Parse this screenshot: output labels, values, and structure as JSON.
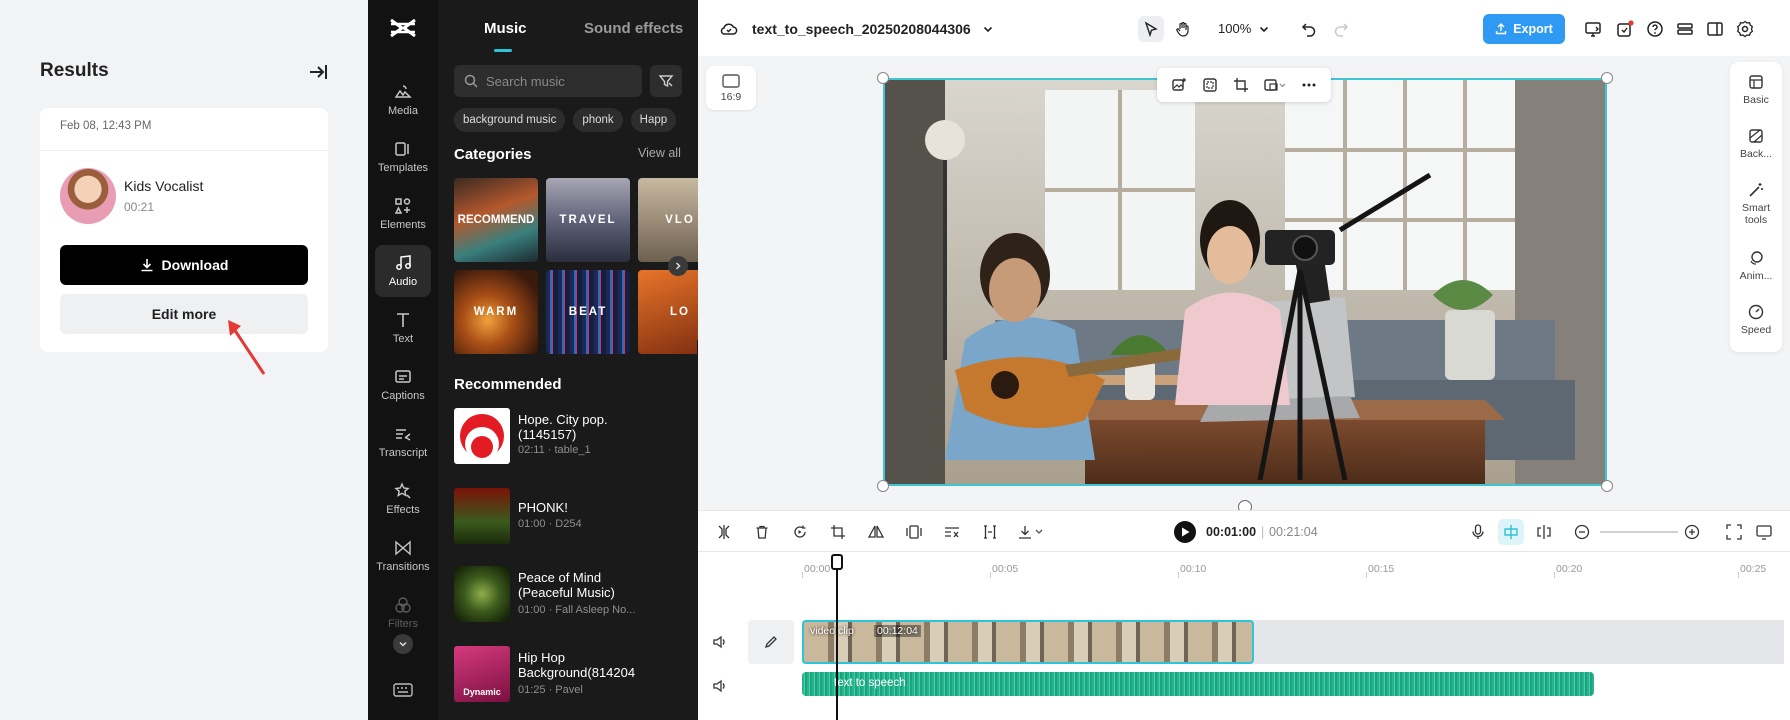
{
  "results": {
    "title": "Results",
    "card": {
      "date": "Feb 08, 12:43 PM",
      "voice_name": "Kids Vocalist",
      "duration": "00:21",
      "download_label": "Download",
      "edit_more_label": "Edit more"
    }
  },
  "nav": {
    "items": [
      {
        "label": "Media",
        "icon": "media-icon"
      },
      {
        "label": "Templates",
        "icon": "templates-icon"
      },
      {
        "label": "Elements",
        "icon": "elements-icon"
      },
      {
        "label": "Audio",
        "icon": "audio-icon",
        "active": true
      },
      {
        "label": "Text",
        "icon": "text-icon"
      },
      {
        "label": "Captions",
        "icon": "captions-icon"
      },
      {
        "label": "Transcript",
        "icon": "transcript-icon"
      },
      {
        "label": "Effects",
        "icon": "effects-icon"
      },
      {
        "label": "Transitions",
        "icon": "transitions-icon"
      },
      {
        "label": "Filters",
        "icon": "filters-icon"
      }
    ]
  },
  "music": {
    "tabs": [
      "Music",
      "Sound effects"
    ],
    "search_placeholder": "Search music",
    "chips": [
      "background music",
      "phonk",
      "Happ"
    ],
    "categories_title": "Categories",
    "view_all": "View all",
    "categories": [
      "RECOMMEND",
      "TRAVEL",
      "VLO",
      "WARM",
      "BEAT",
      "LO"
    ],
    "recommended_title": "Recommended",
    "tracks": [
      {
        "title": "Hope. City pop.(1145157)",
        "sub": "02:11 · table_1"
      },
      {
        "title": "PHONK!",
        "sub": "01:00 · D254"
      },
      {
        "title": "Peace of Mind (Peaceful Music)",
        "sub": "01:00 · Fall Asleep No..."
      },
      {
        "title": "Hip Hop Background(814204",
        "sub": "01:25 · Pavel",
        "badge": "Dynamic"
      }
    ]
  },
  "editor": {
    "project_title": "text_to_speech_20250208044306",
    "zoom": "100%",
    "export_label": "Export",
    "aspect_ratio": "16:9",
    "accent_color": "#2f9af3",
    "selection_color": "#3fc5d4",
    "right_panel": [
      "Basic",
      "Back...",
      "Smart tools",
      "Anim...",
      "Speed"
    ]
  },
  "timeline": {
    "current_time": "00:01:00",
    "total_time": "00:21:04",
    "ruler": [
      "00:00",
      "00:05",
      "00:10",
      "00:15",
      "00:20",
      "00:25"
    ],
    "video_clip": {
      "label": "video clip",
      "duration": "00:12:04"
    },
    "audio_clip": {
      "label": "text to speech"
    }
  }
}
